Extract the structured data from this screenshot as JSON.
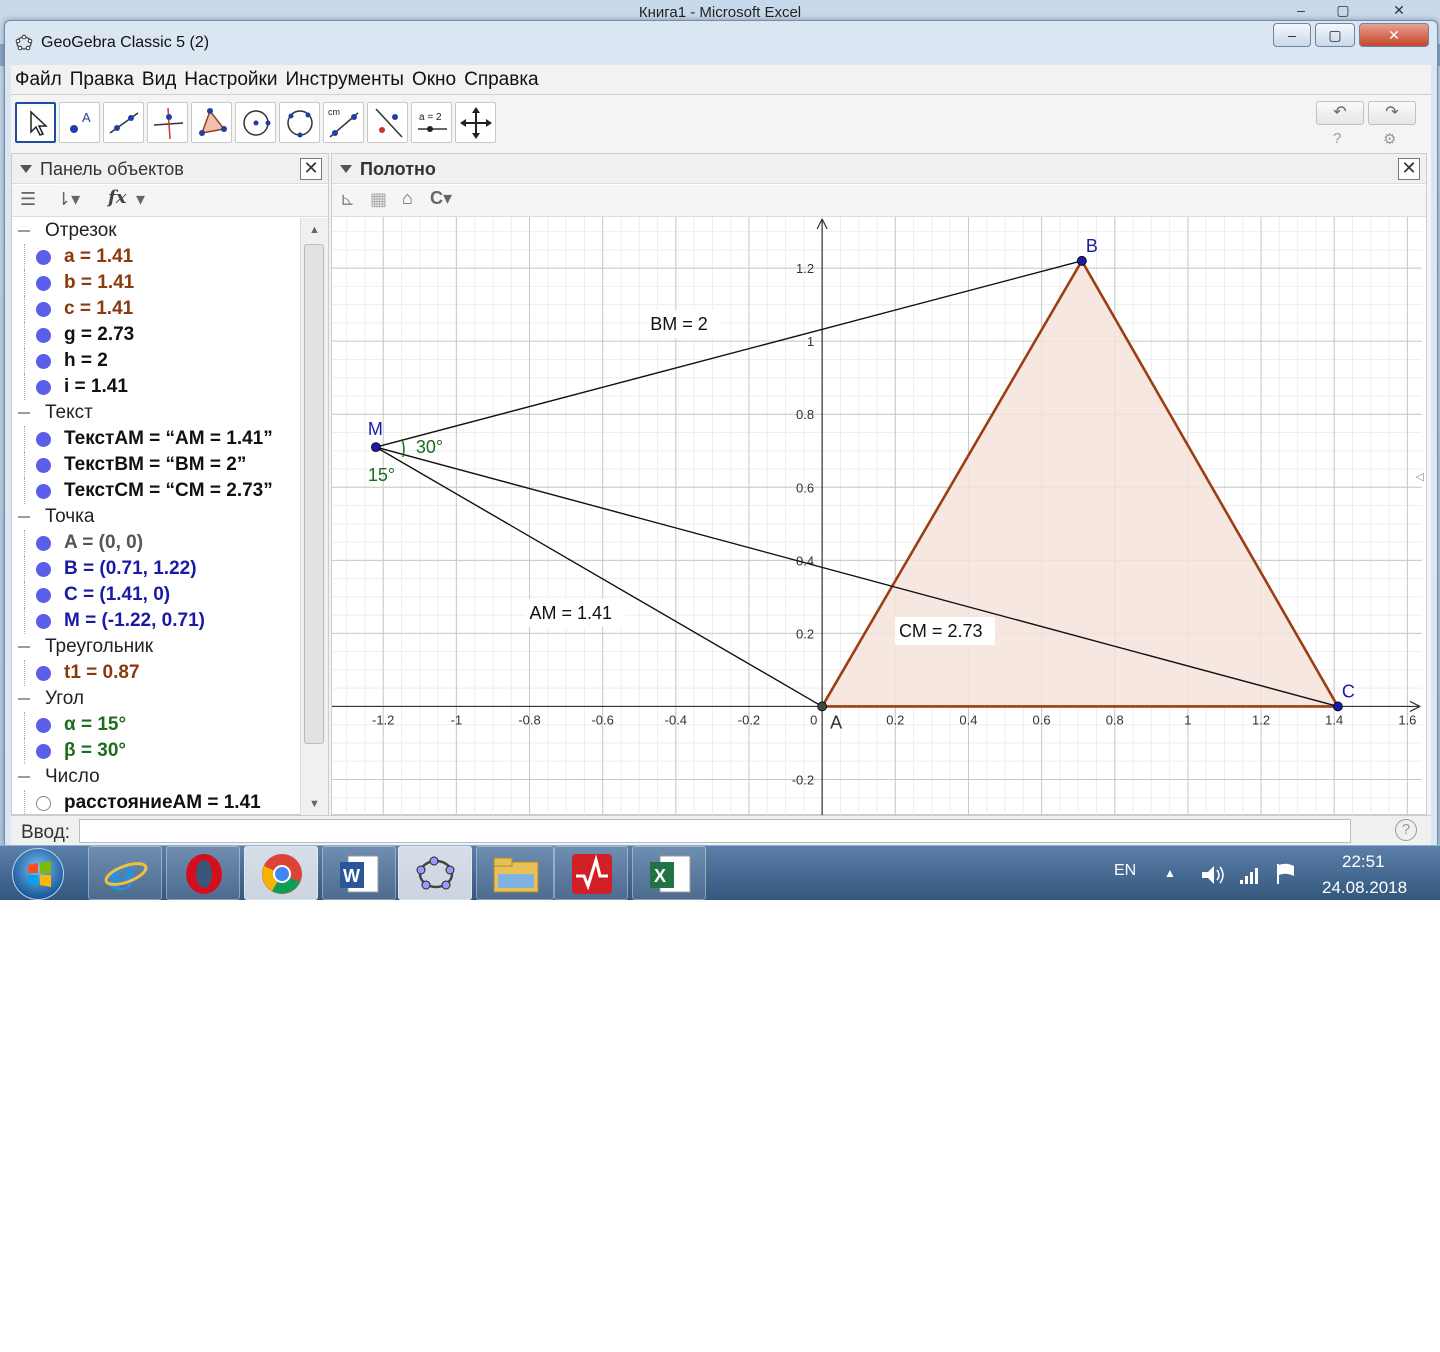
{
  "background_window": {
    "title": "Книга1 - Microsoft Excel",
    "min": "–",
    "max": "▢",
    "close": "✕"
  },
  "window": {
    "title": "GeoGebra Classic 5 (2)",
    "min": "–",
    "max": "▢",
    "close": "✕"
  },
  "menu": [
    "Файл",
    "Правка",
    "Вид",
    "Настройки",
    "Инструменты",
    "Окно",
    "Справка"
  ],
  "tools": [
    "move-tool",
    "point-tool",
    "line-tool",
    "perpendicular-tool",
    "polygon-tool",
    "circle-tool",
    "ellipse-tool",
    "angle-tool",
    "reflect-tool",
    "slider-tool",
    "move-view-tool"
  ],
  "toolbar": {
    "undo": "↶",
    "redo": "↷",
    "help": "?",
    "settings": "⚙",
    "slider_label": "a = 2",
    "measure_label": "cm"
  },
  "algebra": {
    "title": "Панель объектов",
    "close": "✕",
    "fx": "fx",
    "groups": [
      {
        "name": "Отрезок",
        "items": [
          {
            "text": "a = 1.41",
            "color": "brown"
          },
          {
            "text": "b = 1.41",
            "color": "brown"
          },
          {
            "text": "c = 1.41",
            "color": "brown"
          },
          {
            "text": "g = 2.73",
            "color": "black"
          },
          {
            "text": "h = 2",
            "color": "black"
          },
          {
            "text": "i = 1.41",
            "color": "black"
          }
        ]
      },
      {
        "name": "Текст",
        "items": [
          {
            "text": "ТекстAM = “AM = 1.41”",
            "color": "black"
          },
          {
            "text": "ТекстBM = “BM = 2”",
            "color": "black"
          },
          {
            "text": "ТекстCM = “CM = 2.73”",
            "color": "black"
          }
        ]
      },
      {
        "name": "Точка",
        "items": [
          {
            "text": "A = (0, 0)",
            "color": "gray"
          },
          {
            "text": "B = (0.71, 1.22)",
            "color": "blue"
          },
          {
            "text": "C = (1.41, 0)",
            "color": "blue"
          },
          {
            "text": "M = (-1.22, 0.71)",
            "color": "blue"
          }
        ]
      },
      {
        "name": "Треугольник",
        "items": [
          {
            "text": "t1 = 0.87",
            "color": "brown"
          }
        ]
      },
      {
        "name": "Угол",
        "items": [
          {
            "text": "α = 15°",
            "color": "green"
          },
          {
            "text": "β = 30°",
            "color": "green"
          }
        ]
      },
      {
        "name": "Число",
        "items": [
          {
            "text": "расстояниеAM = 1.41",
            "color": "black",
            "hidden": true
          }
        ]
      }
    ]
  },
  "graphics": {
    "title": "Полотно",
    "close": "✕",
    "x_ticks": [
      "-1.2",
      "-1",
      "-0.8",
      "-0.6",
      "-0.4",
      "-0.2",
      "0",
      "0.2",
      "0.4",
      "0.6",
      "0.8",
      "1",
      "1.2",
      "1.4",
      "1.6"
    ],
    "y_ticks": [
      "1.2",
      "1",
      "0.8",
      "0.6",
      "0.4",
      "0.2",
      "-0.2"
    ],
    "xlim": [
      -1.34,
      1.64
    ],
    "ylim": [
      -0.3,
      1.34
    ],
    "points": [
      {
        "name": "A",
        "x": 0,
        "y": 0
      },
      {
        "name": "B",
        "x": 0.71,
        "y": 1.22
      },
      {
        "name": "C",
        "x": 1.41,
        "y": 0
      },
      {
        "name": "M",
        "x": -1.22,
        "y": 0.71
      }
    ],
    "labels": {
      "AM": "AM = 1.41",
      "BM": "BM = 2",
      "CM": "CM = 2.73",
      "angle_alpha": "15°",
      "angle_beta": "30°"
    },
    "colors": {
      "triangle_edge": "#9b3f12",
      "triangle_fill": "#f6e3dc",
      "segment": "#111111",
      "point": "#1a1aa6",
      "angle": "#1d6b1d",
      "grid_major": "#c8c8c8",
      "grid_minor": "#eeeeee"
    }
  },
  "input": {
    "label": "Ввод:",
    "value": "",
    "help": "?"
  },
  "taskbar": {
    "apps": [
      "ie-icon",
      "opera-icon",
      "chrome-icon",
      "word-icon",
      "geogebra-icon",
      "explorer-icon",
      "presentation-icon",
      "excel-icon"
    ],
    "lang": "EN",
    "tray_arrow": "▲",
    "time": "22:51",
    "date": "24.08.2018"
  }
}
